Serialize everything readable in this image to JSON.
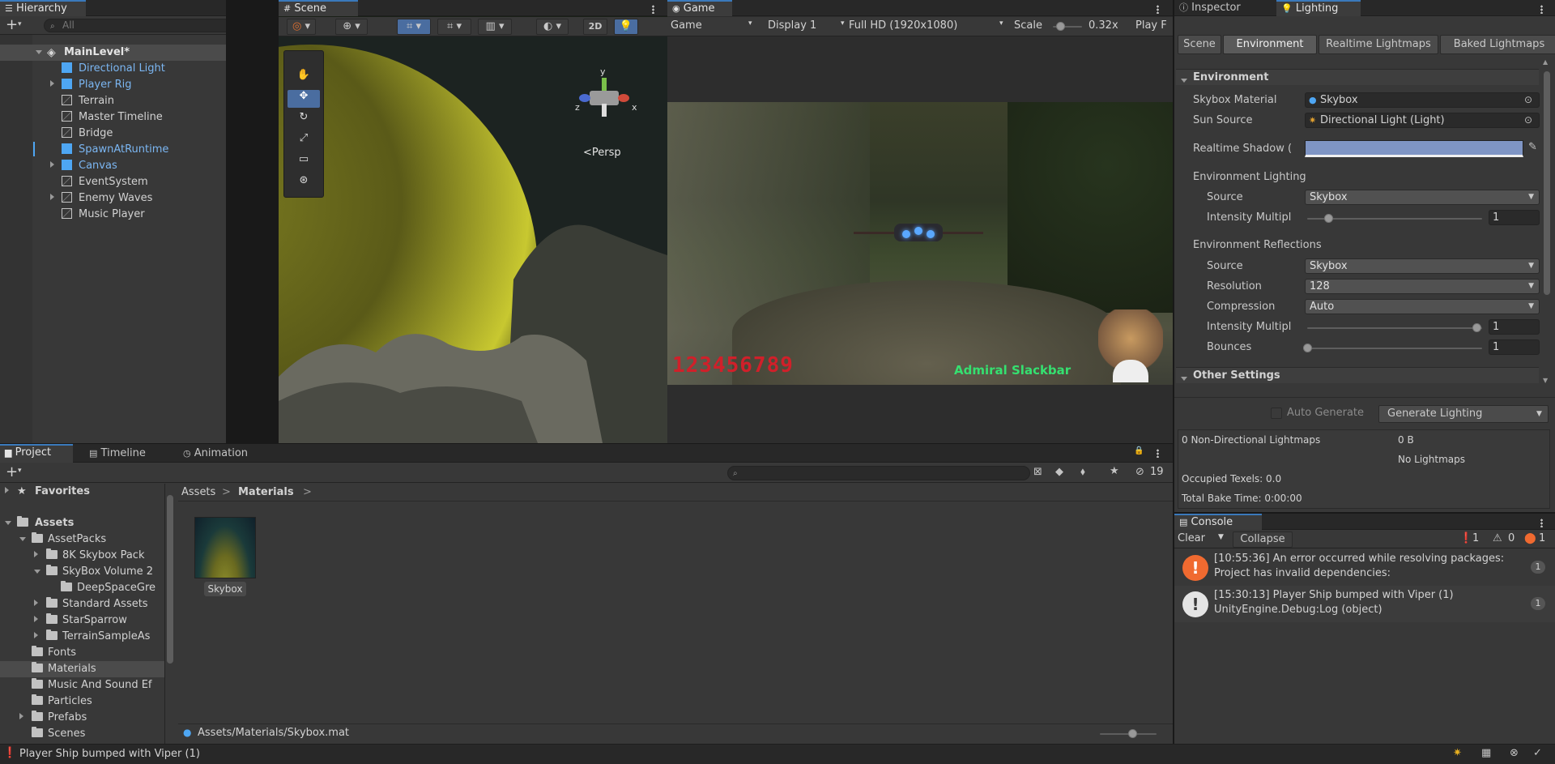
{
  "hierarchy": {
    "tab_label": "Hierarchy",
    "search_placeholder": "All",
    "scene_name": "MainLevel*",
    "items": [
      {
        "label": "Directional Light",
        "indent": 1,
        "prefab": true,
        "arrow": "right",
        "expander": false
      },
      {
        "label": "Player Rig",
        "indent": 1,
        "prefab": true,
        "arrow": "right",
        "expander": true
      },
      {
        "label": "Terrain",
        "indent": 1,
        "prefab": false,
        "arrow": "",
        "expander": false
      },
      {
        "label": "Master Timeline",
        "indent": 1,
        "prefab": false,
        "arrow": "",
        "expander": false
      },
      {
        "label": "Bridge",
        "indent": 1,
        "prefab": false,
        "arrow": "",
        "expander": false
      },
      {
        "label": "SpawnAtRuntime",
        "indent": 1,
        "prefab": true,
        "arrow": "right",
        "expander": false
      },
      {
        "label": "Canvas",
        "indent": 1,
        "prefab": true,
        "arrow": "right",
        "expander": true
      },
      {
        "label": "EventSystem",
        "indent": 1,
        "prefab": false,
        "arrow": "",
        "expander": false
      },
      {
        "label": "Enemy Waves",
        "indent": 1,
        "prefab": false,
        "arrow": "",
        "expander": true
      },
      {
        "label": "Music Player",
        "indent": 1,
        "prefab": false,
        "arrow": "",
        "expander": false
      }
    ]
  },
  "scene": {
    "tab_label": "Scene",
    "toggle_2d": "2D",
    "persp_label": "<Persp",
    "gizmo_axes": {
      "y": "y",
      "x": "x",
      "z": "z"
    }
  },
  "game": {
    "tab_label": "Game",
    "mode": "Game",
    "display": "Display 1",
    "resolution": "Full HD (1920x1080)",
    "scale_label": "Scale",
    "scale_value": "0.32x",
    "play_label": "Play F",
    "hud_score": "123456789",
    "hud_name": "Admiral Slackbar"
  },
  "inspector": {
    "tab_inspector": "Inspector",
    "tab_lighting": "Lighting",
    "subtabs": [
      "Scene",
      "Environment",
      "Realtime Lightmaps",
      "Baked Lightmaps"
    ],
    "section_environment": "Environment",
    "skybox_material_label": "Skybox Material",
    "skybox_material_value": "Skybox",
    "sun_source_label": "Sun Source",
    "sun_source_value": "Directional Light (Light)",
    "realtime_shadow_label": "Realtime Shadow (",
    "shadow_color": "#7f95c4",
    "env_lighting_label": "Environment Lighting",
    "env_lighting_source_label": "Source",
    "env_lighting_source_value": "Skybox",
    "env_lighting_intensity_label": "Intensity Multipl",
    "env_lighting_intensity_value": "1",
    "env_reflections_label": "Environment Reflections",
    "reflections_source_label": "Source",
    "reflections_source_value": "Skybox",
    "reflections_resolution_label": "Resolution",
    "reflections_resolution_value": "128",
    "reflections_compression_label": "Compression",
    "reflections_compression_value": "Auto",
    "reflections_intensity_label": "Intensity Multipl",
    "reflections_intensity_value": "1",
    "reflections_bounces_label": "Bounces",
    "reflections_bounces_value": "1",
    "section_other": "Other Settings",
    "auto_generate_label": "Auto Generate",
    "generate_lighting_label": "Generate Lighting",
    "stats_lightmaps": "0 Non-Directional Lightmaps",
    "stats_size": "0 B",
    "stats_no_lightmaps": "No Lightmaps",
    "stats_texels": "Occupied Texels: 0.0",
    "stats_bake_time": "Total Bake Time: 0:00:00"
  },
  "project": {
    "tab_project": "Project",
    "tab_timeline": "Timeline",
    "tab_animation": "Animation",
    "hidden_count": "19",
    "favorites_label": "Favorites",
    "assets_label": "Assets",
    "tree": [
      {
        "label": "AssetPacks",
        "indent": 1,
        "arrow": "down"
      },
      {
        "label": "8K Skybox Pack",
        "indent": 2,
        "arrow": "right"
      },
      {
        "label": "SkyBox Volume 2",
        "indent": 2,
        "arrow": "down"
      },
      {
        "label": "DeepSpaceGre",
        "indent": 3,
        "arrow": ""
      },
      {
        "label": "Standard Assets",
        "indent": 2,
        "arrow": "right"
      },
      {
        "label": "StarSparrow",
        "indent": 2,
        "arrow": "right"
      },
      {
        "label": "TerrainSampleAs",
        "indent": 2,
        "arrow": "right"
      },
      {
        "label": "Fonts",
        "indent": 1,
        "arrow": ""
      },
      {
        "label": "Materials",
        "indent": 1,
        "arrow": "",
        "selected": true
      },
      {
        "label": "Music And Sound Ef",
        "indent": 1,
        "arrow": ""
      },
      {
        "label": "Particles",
        "indent": 1,
        "arrow": ""
      },
      {
        "label": "Prefabs",
        "indent": 1,
        "arrow": "right"
      },
      {
        "label": "Scenes",
        "indent": 1,
        "arrow": ""
      }
    ],
    "breadcrumb": [
      "Assets",
      "Materials"
    ],
    "asset_name": "Skybox",
    "asset_path": "Assets/Materials/Skybox.mat"
  },
  "console": {
    "tab_label": "Console",
    "clear_label": "Clear",
    "collapse_label": "Collapse",
    "count_info": "1",
    "count_warn": "0",
    "count_error": "1",
    "entries": [
      {
        "type": "error",
        "line1": "[10:55:36] An error occurred while resolving packages:",
        "line2": "Project has invalid dependencies:",
        "count": "1"
      },
      {
        "type": "info",
        "line1": "[15:30:13] Player Ship bumped with Viper (1)",
        "line2": "UnityEngine.Debug:Log (object)",
        "count": "1"
      }
    ]
  },
  "status_bar": {
    "message": "Player Ship bumped with Viper (1)"
  }
}
